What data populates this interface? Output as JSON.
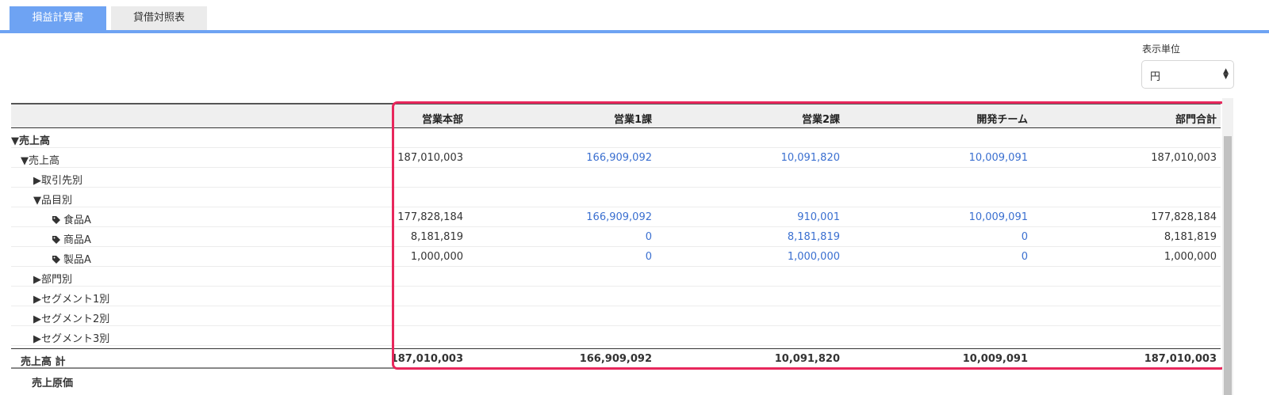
{
  "tabs": [
    {
      "label": "損益計算書",
      "active": true
    },
    {
      "label": "貸借対照表",
      "active": false
    }
  ],
  "unit": {
    "label": "表示単位",
    "value": "円"
  },
  "columns": [
    "営業本部",
    "営業1課",
    "営業2課",
    "開発チーム",
    "部門合計"
  ],
  "rows": [
    {
      "label": "▼売上高",
      "values": [
        "",
        "",
        "",
        "",
        ""
      ],
      "bold": true
    },
    {
      "label": "▼売上高",
      "values": [
        "187,010,003",
        "166,909,092",
        "10,091,820",
        "10,009,091",
        "187,010,003"
      ]
    },
    {
      "label": "▶取引先別",
      "values": [
        "",
        "",
        "",
        "",
        ""
      ]
    },
    {
      "label": "▼品目別",
      "values": [
        "",
        "",
        "",
        "",
        ""
      ]
    },
    {
      "label": "食品A",
      "values": [
        "177,828,184",
        "166,909,092",
        "910,001",
        "10,009,091",
        "177,828,184"
      ],
      "icon": "tag-icon"
    },
    {
      "label": "商品A",
      "values": [
        "8,181,819",
        "0",
        "8,181,819",
        "0",
        "8,181,819"
      ],
      "icon": "tag-icon"
    },
    {
      "label": "製品A",
      "values": [
        "1,000,000",
        "0",
        "1,000,000",
        "0",
        "1,000,000"
      ],
      "icon": "tag-icon"
    },
    {
      "label": "▶部門別",
      "values": [
        "",
        "",
        "",
        "",
        ""
      ]
    },
    {
      "label": "▶セグメント1別",
      "values": [
        "",
        "",
        "",
        "",
        ""
      ]
    },
    {
      "label": "▶セグメント2別",
      "values": [
        "",
        "",
        "",
        "",
        ""
      ]
    },
    {
      "label": "▶セグメント3別",
      "values": [
        "",
        "",
        "",
        "",
        ""
      ]
    }
  ],
  "total": {
    "label": "売上高 計",
    "values": [
      "187,010,003",
      "166,909,092",
      "10,091,820",
      "10,009,091",
      "187,010,003"
    ]
  },
  "next_section": "売上原価",
  "colors": {
    "accent": "#6ea3f3",
    "link": "#3a6fd0",
    "highlight": "#e8275c"
  }
}
